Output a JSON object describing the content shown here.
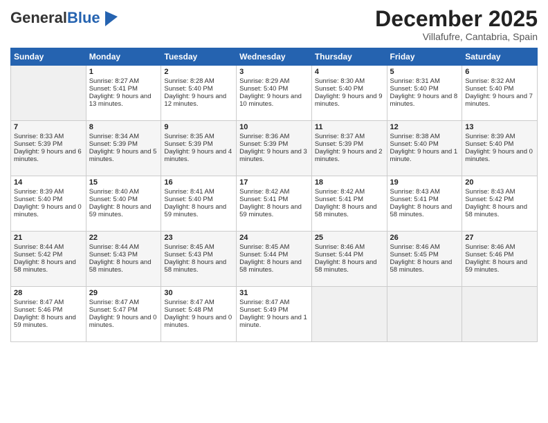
{
  "logo": {
    "general": "General",
    "blue": "Blue"
  },
  "header": {
    "month": "December 2025",
    "location": "Villafufre, Cantabria, Spain"
  },
  "days_of_week": [
    "Sunday",
    "Monday",
    "Tuesday",
    "Wednesday",
    "Thursday",
    "Friday",
    "Saturday"
  ],
  "weeks": [
    [
      {
        "day": "",
        "empty": true
      },
      {
        "day": "1",
        "sunrise": "Sunrise: 8:27 AM",
        "sunset": "Sunset: 5:41 PM",
        "daylight": "Daylight: 9 hours and 13 minutes."
      },
      {
        "day": "2",
        "sunrise": "Sunrise: 8:28 AM",
        "sunset": "Sunset: 5:40 PM",
        "daylight": "Daylight: 9 hours and 12 minutes."
      },
      {
        "day": "3",
        "sunrise": "Sunrise: 8:29 AM",
        "sunset": "Sunset: 5:40 PM",
        "daylight": "Daylight: 9 hours and 10 minutes."
      },
      {
        "day": "4",
        "sunrise": "Sunrise: 8:30 AM",
        "sunset": "Sunset: 5:40 PM",
        "daylight": "Daylight: 9 hours and 9 minutes."
      },
      {
        "day": "5",
        "sunrise": "Sunrise: 8:31 AM",
        "sunset": "Sunset: 5:40 PM",
        "daylight": "Daylight: 9 hours and 8 minutes."
      },
      {
        "day": "6",
        "sunrise": "Sunrise: 8:32 AM",
        "sunset": "Sunset: 5:40 PM",
        "daylight": "Daylight: 9 hours and 7 minutes."
      }
    ],
    [
      {
        "day": "7",
        "sunrise": "Sunrise: 8:33 AM",
        "sunset": "Sunset: 5:39 PM",
        "daylight": "Daylight: 9 hours and 6 minutes."
      },
      {
        "day": "8",
        "sunrise": "Sunrise: 8:34 AM",
        "sunset": "Sunset: 5:39 PM",
        "daylight": "Daylight: 9 hours and 5 minutes."
      },
      {
        "day": "9",
        "sunrise": "Sunrise: 8:35 AM",
        "sunset": "Sunset: 5:39 PM",
        "daylight": "Daylight: 9 hours and 4 minutes."
      },
      {
        "day": "10",
        "sunrise": "Sunrise: 8:36 AM",
        "sunset": "Sunset: 5:39 PM",
        "daylight": "Daylight: 9 hours and 3 minutes."
      },
      {
        "day": "11",
        "sunrise": "Sunrise: 8:37 AM",
        "sunset": "Sunset: 5:39 PM",
        "daylight": "Daylight: 9 hours and 2 minutes."
      },
      {
        "day": "12",
        "sunrise": "Sunrise: 8:38 AM",
        "sunset": "Sunset: 5:40 PM",
        "daylight": "Daylight: 9 hours and 1 minute."
      },
      {
        "day": "13",
        "sunrise": "Sunrise: 8:39 AM",
        "sunset": "Sunset: 5:40 PM",
        "daylight": "Daylight: 9 hours and 0 minutes."
      }
    ],
    [
      {
        "day": "14",
        "sunrise": "Sunrise: 8:39 AM",
        "sunset": "Sunset: 5:40 PM",
        "daylight": "Daylight: 9 hours and 0 minutes."
      },
      {
        "day": "15",
        "sunrise": "Sunrise: 8:40 AM",
        "sunset": "Sunset: 5:40 PM",
        "daylight": "Daylight: 8 hours and 59 minutes."
      },
      {
        "day": "16",
        "sunrise": "Sunrise: 8:41 AM",
        "sunset": "Sunset: 5:40 PM",
        "daylight": "Daylight: 8 hours and 59 minutes."
      },
      {
        "day": "17",
        "sunrise": "Sunrise: 8:42 AM",
        "sunset": "Sunset: 5:41 PM",
        "daylight": "Daylight: 8 hours and 59 minutes."
      },
      {
        "day": "18",
        "sunrise": "Sunrise: 8:42 AM",
        "sunset": "Sunset: 5:41 PM",
        "daylight": "Daylight: 8 hours and 58 minutes."
      },
      {
        "day": "19",
        "sunrise": "Sunrise: 8:43 AM",
        "sunset": "Sunset: 5:41 PM",
        "daylight": "Daylight: 8 hours and 58 minutes."
      },
      {
        "day": "20",
        "sunrise": "Sunrise: 8:43 AM",
        "sunset": "Sunset: 5:42 PM",
        "daylight": "Daylight: 8 hours and 58 minutes."
      }
    ],
    [
      {
        "day": "21",
        "sunrise": "Sunrise: 8:44 AM",
        "sunset": "Sunset: 5:42 PM",
        "daylight": "Daylight: 8 hours and 58 minutes."
      },
      {
        "day": "22",
        "sunrise": "Sunrise: 8:44 AM",
        "sunset": "Sunset: 5:43 PM",
        "daylight": "Daylight: 8 hours and 58 minutes."
      },
      {
        "day": "23",
        "sunrise": "Sunrise: 8:45 AM",
        "sunset": "Sunset: 5:43 PM",
        "daylight": "Daylight: 8 hours and 58 minutes."
      },
      {
        "day": "24",
        "sunrise": "Sunrise: 8:45 AM",
        "sunset": "Sunset: 5:44 PM",
        "daylight": "Daylight: 8 hours and 58 minutes."
      },
      {
        "day": "25",
        "sunrise": "Sunrise: 8:46 AM",
        "sunset": "Sunset: 5:44 PM",
        "daylight": "Daylight: 8 hours and 58 minutes."
      },
      {
        "day": "26",
        "sunrise": "Sunrise: 8:46 AM",
        "sunset": "Sunset: 5:45 PM",
        "daylight": "Daylight: 8 hours and 58 minutes."
      },
      {
        "day": "27",
        "sunrise": "Sunrise: 8:46 AM",
        "sunset": "Sunset: 5:46 PM",
        "daylight": "Daylight: 8 hours and 59 minutes."
      }
    ],
    [
      {
        "day": "28",
        "sunrise": "Sunrise: 8:47 AM",
        "sunset": "Sunset: 5:46 PM",
        "daylight": "Daylight: 8 hours and 59 minutes."
      },
      {
        "day": "29",
        "sunrise": "Sunrise: 8:47 AM",
        "sunset": "Sunset: 5:47 PM",
        "daylight": "Daylight: 9 hours and 0 minutes."
      },
      {
        "day": "30",
        "sunrise": "Sunrise: 8:47 AM",
        "sunset": "Sunset: 5:48 PM",
        "daylight": "Daylight: 9 hours and 0 minutes."
      },
      {
        "day": "31",
        "sunrise": "Sunrise: 8:47 AM",
        "sunset": "Sunset: 5:49 PM",
        "daylight": "Daylight: 9 hours and 1 minute."
      },
      {
        "day": "",
        "empty": true
      },
      {
        "day": "",
        "empty": true
      },
      {
        "day": "",
        "empty": true
      }
    ]
  ]
}
